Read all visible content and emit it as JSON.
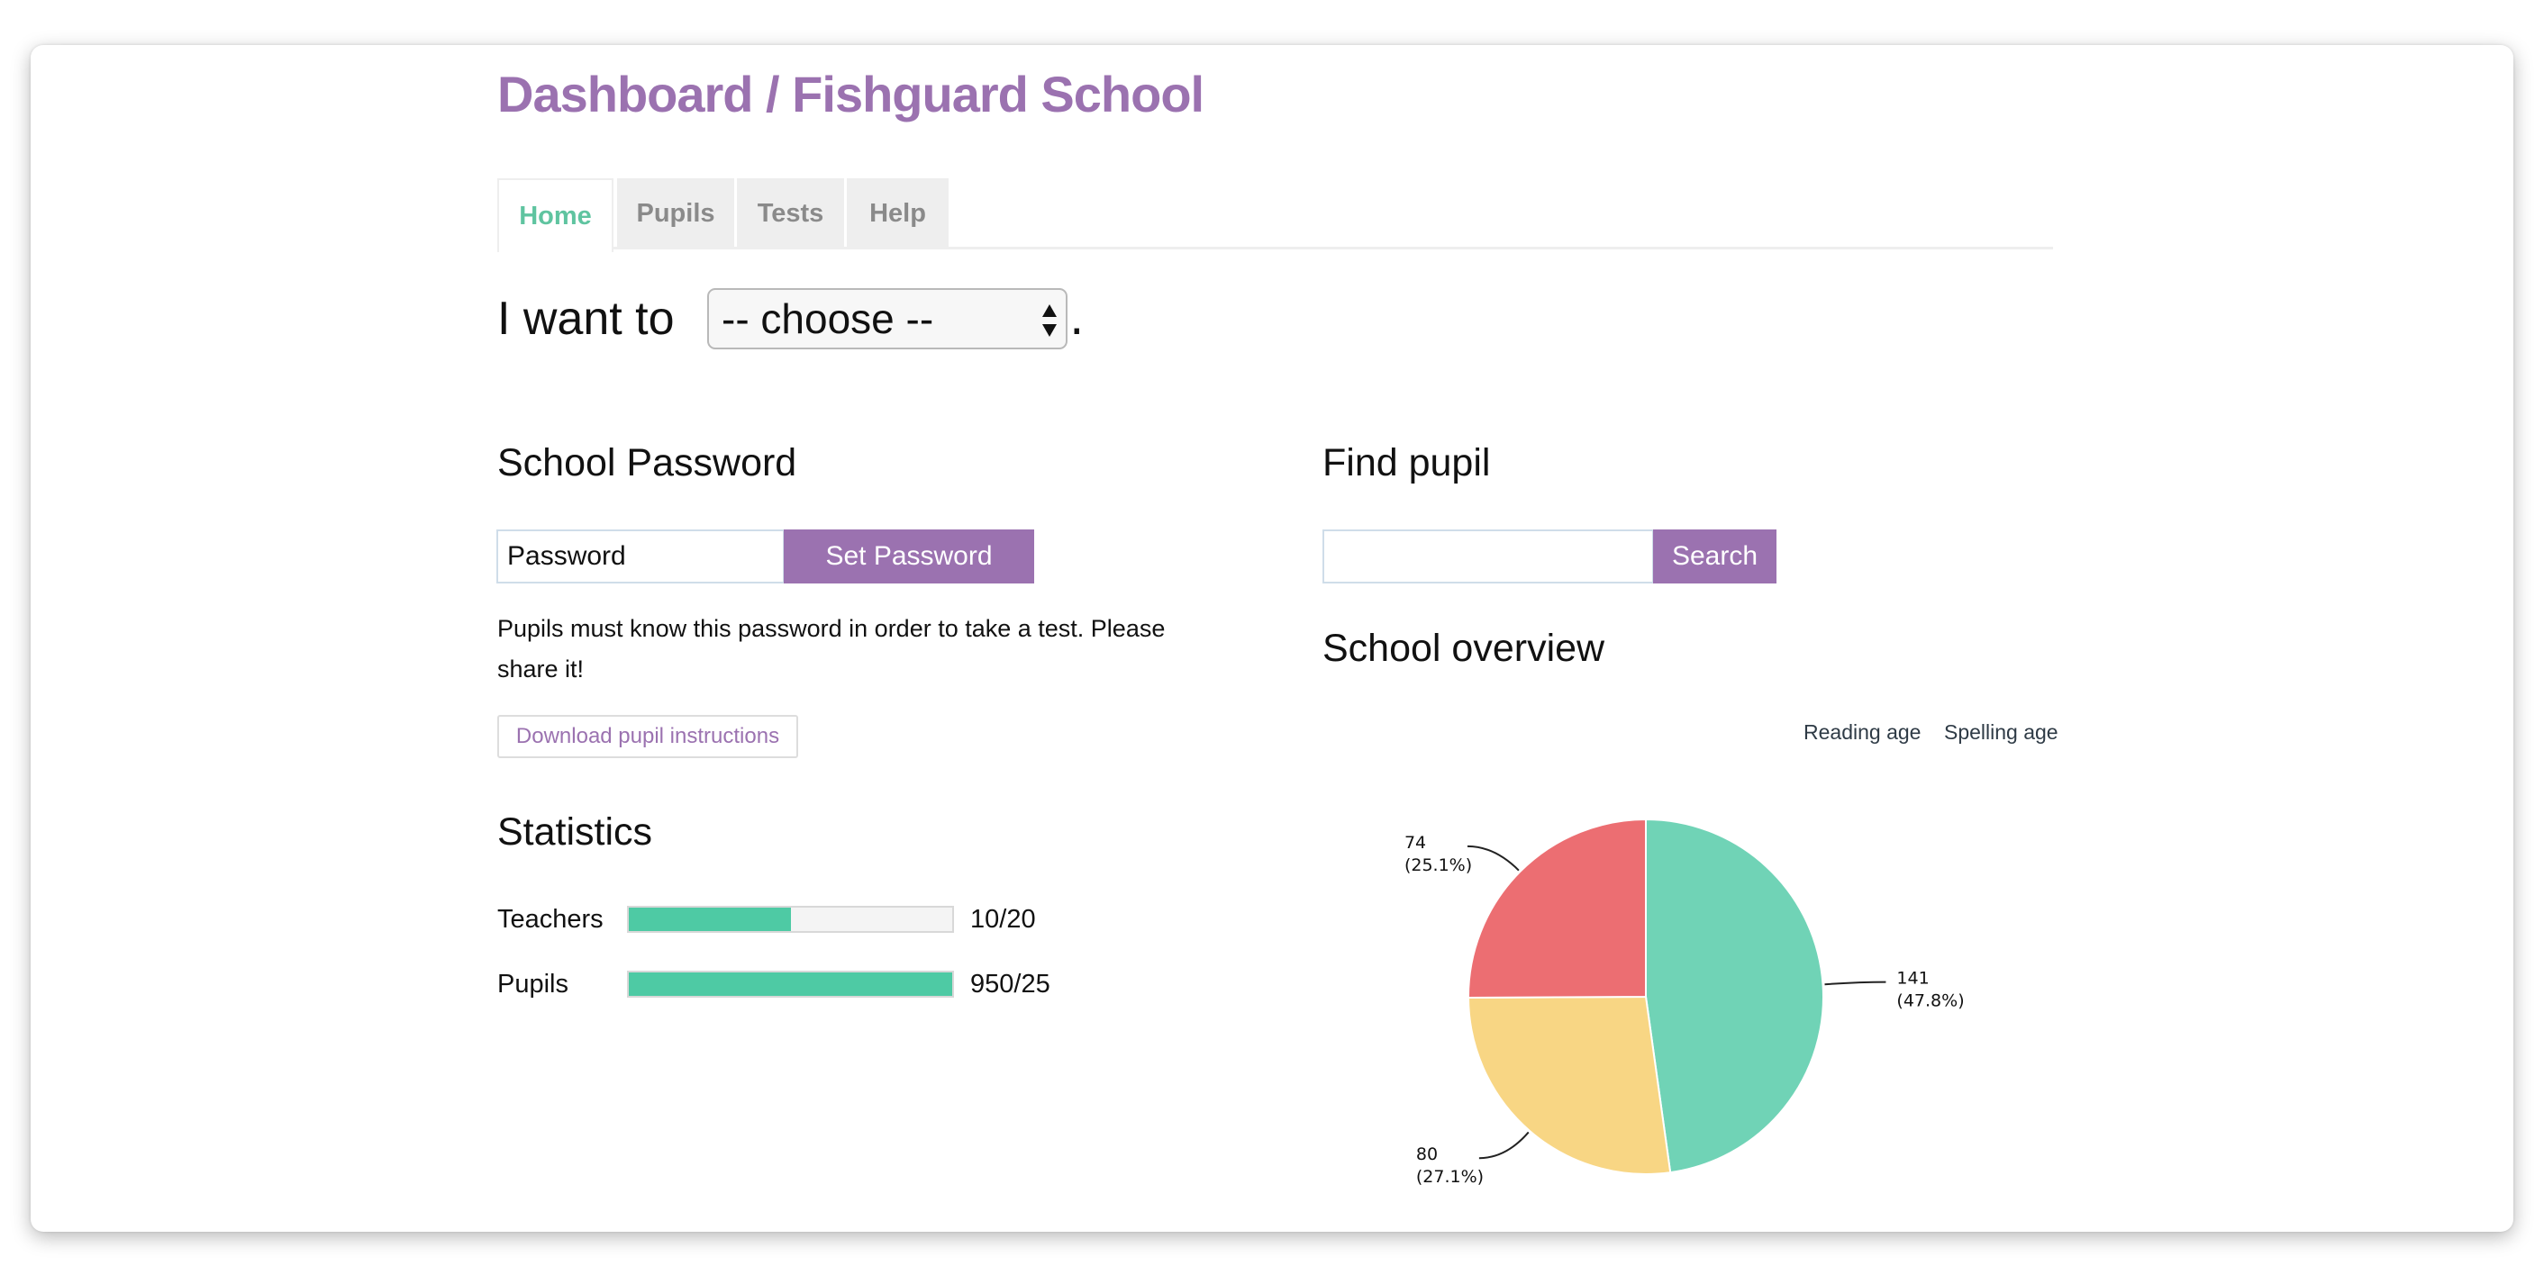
{
  "header": {
    "title": "Dashboard / Fishguard School"
  },
  "tabs": [
    {
      "label": "Home",
      "active": true
    },
    {
      "label": "Pupils",
      "active": false
    },
    {
      "label": "Tests",
      "active": false
    },
    {
      "label": "Help",
      "active": false
    }
  ],
  "action": {
    "prefix": "I want to",
    "select_value": "-- choose --",
    "suffix": "."
  },
  "school_password": {
    "heading": "School Password",
    "input_value": "Password",
    "button_label": "Set Password",
    "help_text": "Pupils must know this password in order to take a test. Please share it!",
    "download_label": "Download pupil instructions"
  },
  "statistics": {
    "heading": "Statistics",
    "rows": [
      {
        "label": "Teachers",
        "value_text": "10/20",
        "fill_fraction": 0.5
      },
      {
        "label": "Pupils",
        "value_text": "950/25",
        "fill_fraction": 1.0
      }
    ]
  },
  "find_pupil": {
    "heading": "Find pupil",
    "input_value": "",
    "button_label": "Search"
  },
  "school_overview": {
    "heading": "School overview",
    "toggles": [
      "Reading age",
      "Spelling age"
    ]
  },
  "colors": {
    "brand_purple": "#9b72b0",
    "active_tab": "#5fc4a0",
    "bar_fill": "#4ecaa4",
    "pie_teal": "#70d3b6",
    "pie_yellow": "#f8d684",
    "pie_red": "#ec6e72"
  },
  "chart_data": {
    "type": "pie",
    "title": "School overview",
    "slices": [
      {
        "value": 141,
        "percent": 47.8,
        "label_line1": "141",
        "label_line2": "(47.8%)",
        "color": "#70d3b6"
      },
      {
        "value": 80,
        "percent": 27.1,
        "label_line1": "80",
        "label_line2": "(27.1%)",
        "color": "#f8d684"
      },
      {
        "value": 74,
        "percent": 25.1,
        "label_line1": "74",
        "label_line2": "(25.1%)",
        "color": "#ec6e72"
      }
    ],
    "start": "top",
    "direction": "clockwise",
    "legend": [
      "Reading age",
      "Spelling age"
    ],
    "legend_position": "top-right"
  }
}
